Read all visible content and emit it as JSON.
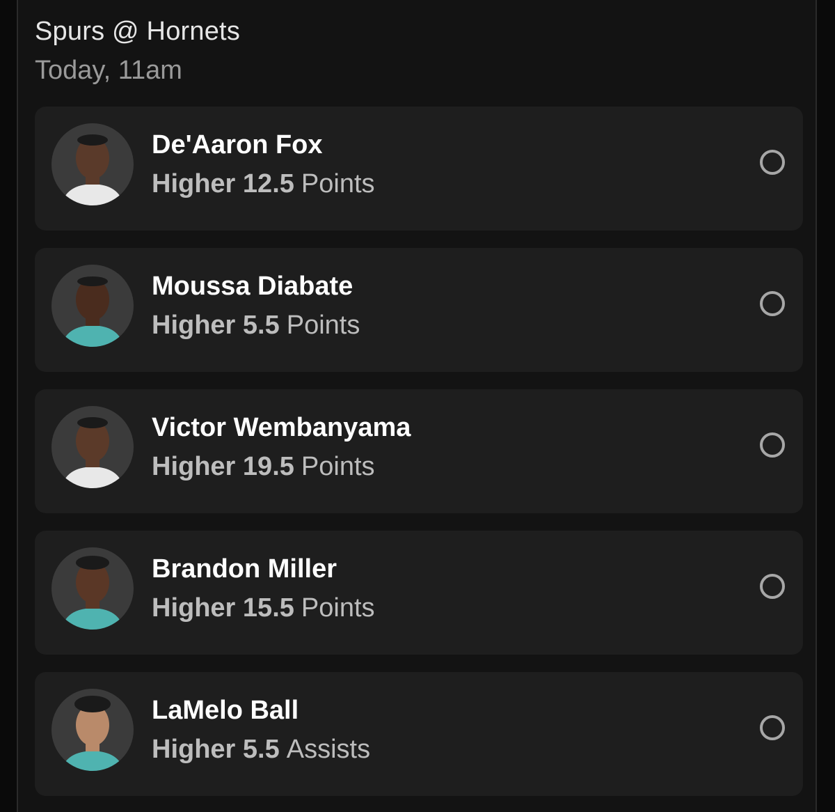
{
  "game": {
    "matchup": "Spurs @ Hornets",
    "time": "Today, 11am"
  },
  "picks": [
    {
      "name": "De'Aaron Fox",
      "direction": "Higher",
      "value": "12.5",
      "stat": "Points",
      "jersey": "#e8e8e8",
      "skin": "#5a3a2a"
    },
    {
      "name": "Moussa Diabate",
      "direction": "Higher",
      "value": "5.5",
      "stat": "Points",
      "jersey": "#4fb3b0",
      "skin": "#4a2c1e"
    },
    {
      "name": "Victor Wembanyama",
      "direction": "Higher",
      "value": "19.5",
      "stat": "Points",
      "jersey": "#e8e8e8",
      "skin": "#5b3a29"
    },
    {
      "name": "Brandon Miller",
      "direction": "Higher",
      "value": "15.5",
      "stat": "Points",
      "jersey": "#4fb3b0",
      "skin": "#5a3726"
    },
    {
      "name": "LaMelo Ball",
      "direction": "Higher",
      "value": "5.5",
      "stat": "Assists",
      "jersey": "#4fb3b0",
      "skin": "#b98a6a"
    }
  ]
}
